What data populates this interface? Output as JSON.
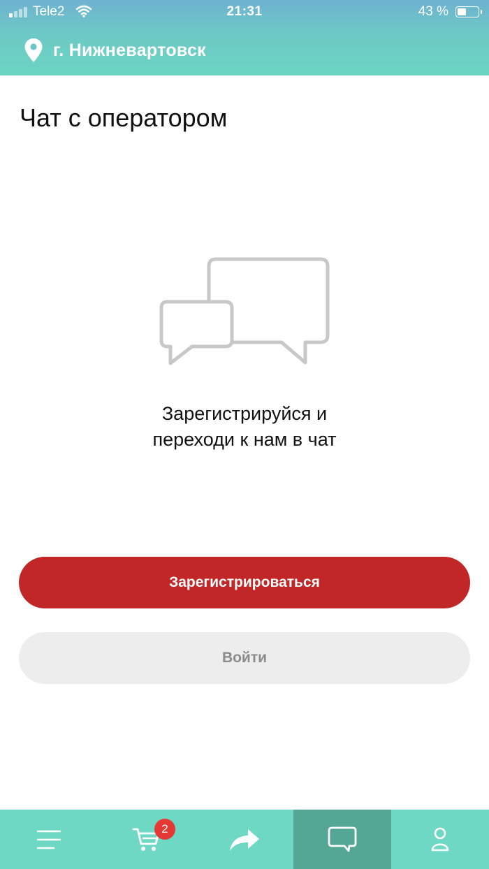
{
  "status_bar": {
    "carrier": "Tele2",
    "time": "21:31",
    "battery_percent": "43 %",
    "battery_level": 0.43,
    "signal_bars_active": 1,
    "signal_bars_total": 4,
    "icons": [
      "signal-icon",
      "wifi-icon",
      "battery-icon"
    ]
  },
  "header": {
    "city": "г. Нижневартовск",
    "icon": "location-pin-icon"
  },
  "page": {
    "title": "Чат с оператором",
    "illustration": "chat-bubbles-icon",
    "prompt_line1": "Зарегистрируйся и",
    "prompt_line2": "переходи к нам в чат"
  },
  "buttons": {
    "register": "Зарегистрироваться",
    "login": "Войти"
  },
  "tab_bar": {
    "items": [
      {
        "name": "menu",
        "icon": "hamburger-menu-icon"
      },
      {
        "name": "cart",
        "icon": "cart-icon",
        "badge": "2"
      },
      {
        "name": "share",
        "icon": "share-arrow-icon"
      },
      {
        "name": "chat",
        "icon": "chat-bubble-icon",
        "active": true
      },
      {
        "name": "profile",
        "icon": "user-icon"
      }
    ]
  },
  "colors": {
    "header_gradient_top": "#6fb2d0",
    "header_gradient_bottom": "#6cd5c2",
    "primary_button": "#c12727",
    "secondary_button": "#eeeded",
    "secondary_button_text": "#8b8b8b",
    "tab_bar": "#6fd8c4",
    "tab_active": "#55a795",
    "badge": "#e53935",
    "illustration_stroke": "#c8c8c8"
  }
}
